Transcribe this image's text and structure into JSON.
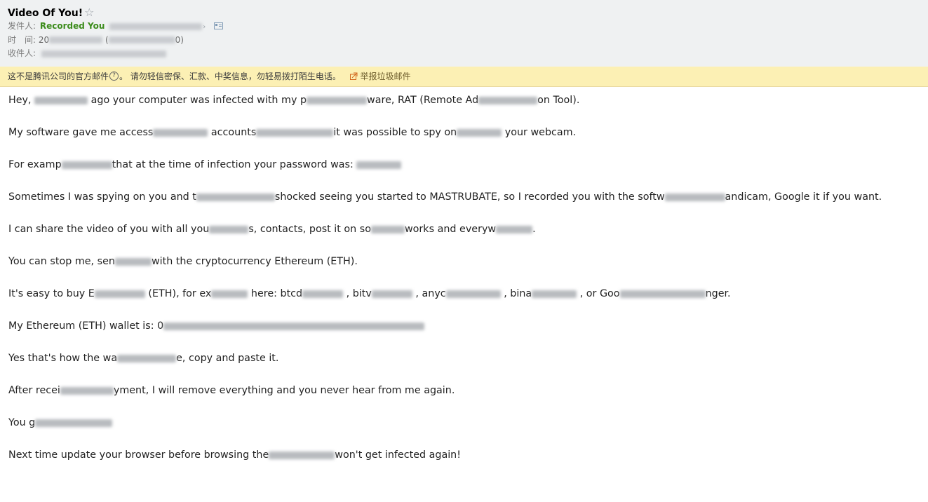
{
  "email": {
    "subject": "Video Of You!",
    "star_glyph": "☆",
    "from_label": "发件人:",
    "from_name": "Recorded You",
    "time_label": "时　间:",
    "time_prefix": "20",
    "time_paren_open": "(",
    "time_suffix": "0)",
    "to_label": "收件人:"
  },
  "warning": {
    "text_a": "这不是腾讯公司的官方邮件",
    "qmark": "?",
    "text_b": "。  请勿轻信密保、汇款、中奖信息，勿轻易拨打陌生电话。",
    "report_label": "举报垃圾邮件"
  },
  "body": {
    "p1": {
      "a": "Hey, ",
      "b": " ago your computer was infected with my p",
      "c": "ware, RAT (Remote Ad",
      "d": "on Tool)."
    },
    "p2": {
      "a": "My software gave me access",
      "b": "accounts",
      "c": "it was possible to spy on",
      "d": "your webcam."
    },
    "p3": {
      "a": "For examp",
      "b": "that at the time of infection your password was: "
    },
    "p4": {
      "a": "Sometimes I was spying on you and t",
      "b": "shocked seeing you started to MASTRUBATE, so I recorded you with the softw",
      "c": "andicam, Google it if you want."
    },
    "p5": {
      "a": "I can share the video of you with all you",
      "b": "s, contacts, post it on so",
      "c": "works and everyw",
      "d": "."
    },
    "p6": {
      "a": "You can stop me, sen",
      "b": "with the cryptocurrency Ethereum (ETH)."
    },
    "p7": {
      "a": "It's easy to buy E",
      "b": "(ETH), for ex",
      "c": " here: btcd",
      "d": " , bitv",
      "e": " , anyc",
      "f": " , bina",
      "g": " , or Goo",
      "h": "nger."
    },
    "p8": {
      "a": "My Ethereum (ETH) wallet is: 0"
    },
    "p9": {
      "a": "Yes that's how the wa",
      "b": "e, copy and paste it."
    },
    "p10": {
      "a": "After recei",
      "b": "yment, I will remove everything and you never hear from me again."
    },
    "p11": {
      "a": "You g"
    },
    "p12": {
      "a": "Next time update your browser before browsing the",
      "b": "won't get infected again!"
    }
  },
  "colors": {
    "header_bg": "#eff1f2",
    "sender_green": "#3c8c1c",
    "warning_bg": "#fcf0b4",
    "body_text": "#222222"
  }
}
